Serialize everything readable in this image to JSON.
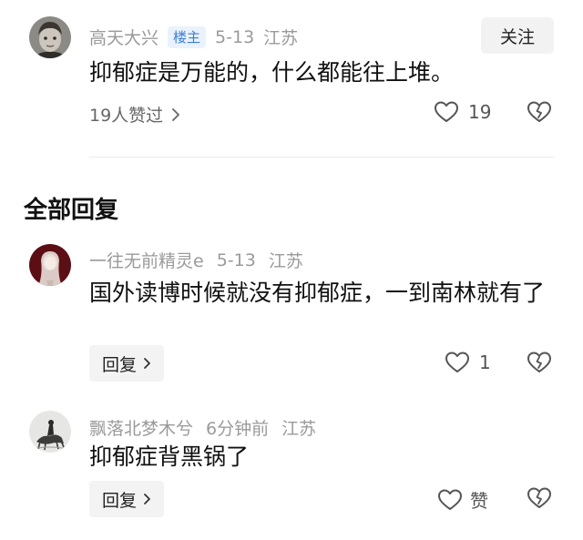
{
  "op_comment": {
    "username": "高天大兴",
    "badge": "楼主",
    "date": "5-13",
    "location": "江苏",
    "follow_label": "关注",
    "text": "抑郁症是万能的，什么都能往上堆。",
    "liked_by": "19人赞过",
    "like_count": "19",
    "avatar_icon": "child-portrait-avatar",
    "accent": "#3b7fd4"
  },
  "replies_section": {
    "title": "全部回复"
  },
  "replies": [
    {
      "username": "一往无前精灵e",
      "date": "5-13",
      "location": "江苏",
      "text": "国外读博时候就没有抑郁症，一到南林就有了",
      "reply_label": "回复",
      "like_count": "1",
      "avatar_icon": "dark-red-figure-avatar"
    },
    {
      "username": "飘落北梦木兮",
      "date": "6分钟前",
      "location": "江苏",
      "text": "抑郁症背黑锅了",
      "reply_label": "回复",
      "like_label": "赞",
      "avatar_icon": "ink-horse-rider-avatar"
    }
  ]
}
